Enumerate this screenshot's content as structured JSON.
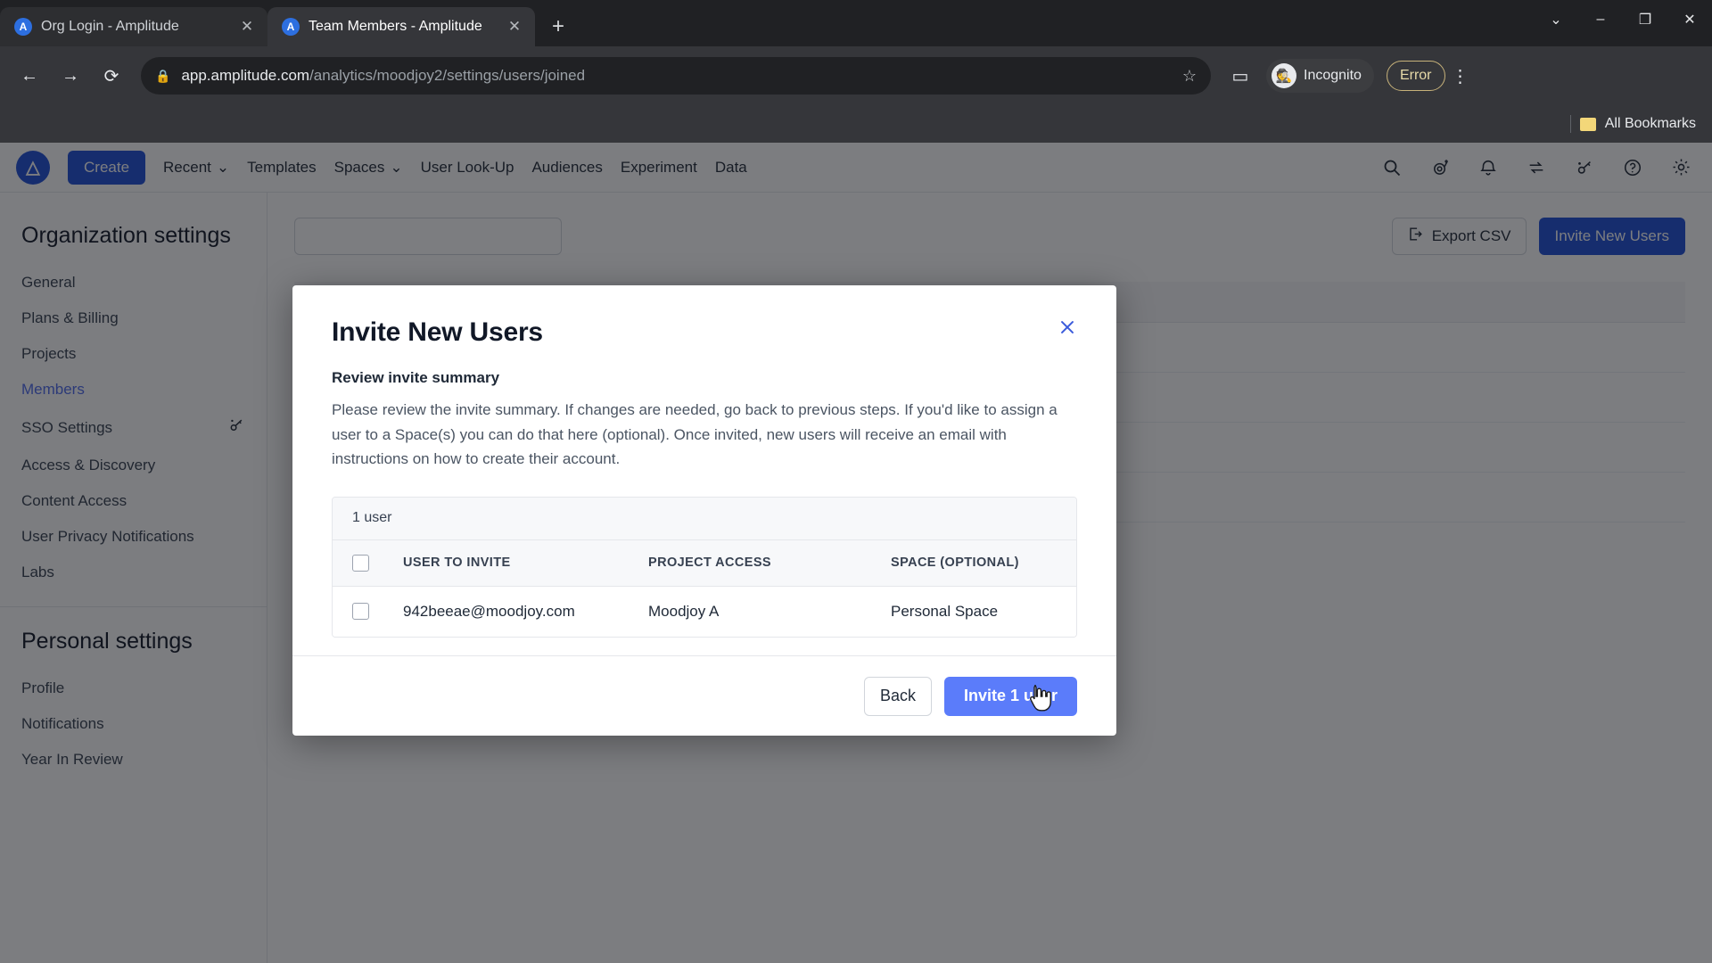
{
  "browser": {
    "tabs": [
      {
        "title": "Org Login - Amplitude",
        "favicon": "amplitude-icon",
        "active": false,
        "close": "✕"
      },
      {
        "title": "Team Members - Amplitude",
        "favicon": "amplitude-icon",
        "active": true,
        "close": "✕"
      }
    ],
    "new_tab_label": "+",
    "window_controls": {
      "expand": "⌄",
      "minimize": "–",
      "maximize": "❐",
      "close": "✕"
    },
    "nav": {
      "back": "←",
      "forward": "→",
      "reload": "⟳"
    },
    "omnibox": {
      "lock": "🔒",
      "url_bold": "app.amplitude.com",
      "url_rest": "/analytics/moodjoy2/settings/users/joined",
      "star": "☆"
    },
    "side_panel_icon": "▭",
    "incognito_label": "Incognito",
    "error_label": "Error",
    "kebab": "⋮",
    "bookmarks_label": "All Bookmarks"
  },
  "appnav": {
    "logo_text": "A",
    "create_label": "Create",
    "links": [
      {
        "label": "Recent",
        "caret": "⌄"
      },
      {
        "label": "Templates",
        "caret": ""
      },
      {
        "label": "Spaces",
        "caret": "⌄"
      },
      {
        "label": "User Look-Up",
        "caret": ""
      },
      {
        "label": "Audiences",
        "caret": ""
      },
      {
        "label": "Experiment",
        "caret": ""
      },
      {
        "label": "Data",
        "caret": ""
      }
    ],
    "icons": [
      {
        "name": "search-icon",
        "glyph": "⌕"
      },
      {
        "name": "snail-icon",
        "glyph": "◔"
      },
      {
        "name": "notifications-bell-icon",
        "glyph": "⌂"
      },
      {
        "name": "swap-icon",
        "glyph": "⇄"
      },
      {
        "name": "magic-key-icon",
        "glyph": "⚷"
      },
      {
        "name": "help-icon",
        "glyph": "?"
      },
      {
        "name": "settings-gear-icon",
        "glyph": "⚙"
      }
    ]
  },
  "sidebar": {
    "org_title": "Organization settings",
    "org_items": [
      {
        "label": "General",
        "active": false,
        "icon": ""
      },
      {
        "label": "Plans & Billing",
        "active": false,
        "icon": ""
      },
      {
        "label": "Projects",
        "active": false,
        "icon": ""
      },
      {
        "label": "Members",
        "active": true,
        "icon": ""
      },
      {
        "label": "SSO Settings",
        "active": false,
        "icon": "magic-key-icon"
      },
      {
        "label": "Access & Discovery",
        "active": false,
        "icon": ""
      },
      {
        "label": "Content Access",
        "active": false,
        "icon": ""
      },
      {
        "label": "User Privacy Notifications",
        "active": false,
        "icon": ""
      },
      {
        "label": "Labs",
        "active": false,
        "icon": ""
      }
    ],
    "personal_title": "Personal settings",
    "personal_items": [
      {
        "label": "Profile"
      },
      {
        "label": "Notifications"
      },
      {
        "label": "Year In Review"
      }
    ]
  },
  "content": {
    "search_placeholder": "",
    "export_label": "Export CSV",
    "export_icon": "export-icon",
    "invite_label": "Invite New Users"
  },
  "modal": {
    "title": "Invite New Users",
    "close_icon": "✕",
    "subtitle": "Review invite summary",
    "description": "Please review the invite summary. If changes are needed, go back to previous steps. If you'd like to assign a user to a Space(s) you can do that here (optional). Once invited, new users will receive an email with instructions on how to create their account.",
    "table": {
      "count_label": "1 user",
      "columns": [
        "USER TO INVITE",
        "PROJECT ACCESS",
        "SPACE (OPTIONAL)"
      ],
      "rows": [
        {
          "user": "942beeae@moodjoy.com",
          "project": "Moodjoy A",
          "space": "Personal Space",
          "checked": false
        }
      ]
    },
    "back_label": "Back",
    "submit_label": "Invite 1 user"
  },
  "colors": {
    "accent_blue": "#1d4ed8",
    "button_blue": "#5b7cfa",
    "active_nav": "#4f6bed",
    "close_blue": "#3b5bdb"
  }
}
